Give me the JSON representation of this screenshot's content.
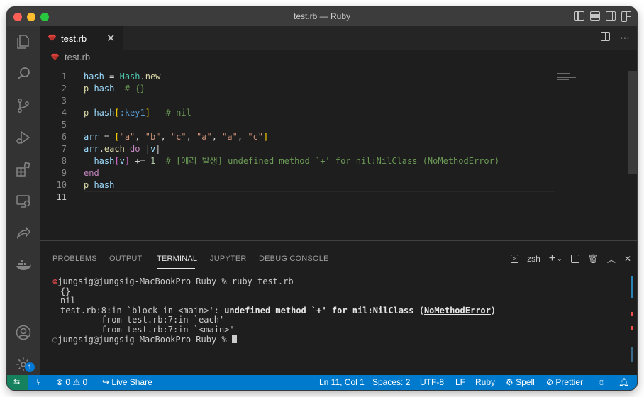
{
  "window": {
    "title": "test.rb — Ruby"
  },
  "tabs": [
    {
      "label": "test.rb",
      "close": "✕"
    }
  ],
  "breadcrumb": {
    "file": "test.rb"
  },
  "editor": {
    "line_numbers": [
      "1",
      "2",
      "3",
      "4",
      "5",
      "6",
      "7",
      "8",
      "9",
      "10",
      "11"
    ],
    "lines": [
      [
        {
          "t": "hash",
          "c": "k-var"
        },
        {
          "t": " = ",
          "c": "k-op"
        },
        {
          "t": "Hash",
          "c": "k-cls"
        },
        {
          "t": ".",
          "c": "k-op"
        },
        {
          "t": "new",
          "c": "k-fn"
        }
      ],
      [
        {
          "t": "p ",
          "c": "k-fn"
        },
        {
          "t": "hash",
          "c": "k-var"
        },
        {
          "t": "  # {}",
          "c": "k-com"
        }
      ],
      [],
      [
        {
          "t": "p ",
          "c": "k-fn"
        },
        {
          "t": "hash",
          "c": "k-var"
        },
        {
          "t": "[",
          "c": "k-br"
        },
        {
          "t": ":key1",
          "c": "k-sym"
        },
        {
          "t": "]",
          "c": "k-br"
        },
        {
          "t": "   # nil",
          "c": "k-com"
        }
      ],
      [],
      [
        {
          "t": "arr",
          "c": "k-var"
        },
        {
          "t": " = ",
          "c": "k-op"
        },
        {
          "t": "[",
          "c": "k-br"
        },
        {
          "t": "\"a\"",
          "c": "k-str"
        },
        {
          "t": ", ",
          "c": "k-op"
        },
        {
          "t": "\"b\"",
          "c": "k-str"
        },
        {
          "t": ", ",
          "c": "k-op"
        },
        {
          "t": "\"c\"",
          "c": "k-str"
        },
        {
          "t": ", ",
          "c": "k-op"
        },
        {
          "t": "\"a\"",
          "c": "k-str"
        },
        {
          "t": ", ",
          "c": "k-op"
        },
        {
          "t": "\"a\"",
          "c": "k-str"
        },
        {
          "t": ", ",
          "c": "k-op"
        },
        {
          "t": "\"c\"",
          "c": "k-str"
        },
        {
          "t": "]",
          "c": "k-br"
        }
      ],
      [
        {
          "t": "arr",
          "c": "k-var"
        },
        {
          "t": ".",
          "c": "k-op"
        },
        {
          "t": "each",
          "c": "k-fn"
        },
        {
          "t": " do ",
          "c": "k-kw"
        },
        {
          "t": "|",
          "c": "k-op"
        },
        {
          "t": "v",
          "c": "k-var"
        },
        {
          "t": "|",
          "c": "k-op"
        }
      ],
      [
        {
          "t": "  ",
          "c": "k-op"
        },
        {
          "t": "hash",
          "c": "k-var"
        },
        {
          "t": "[",
          "c": "k-br2"
        },
        {
          "t": "v",
          "c": "k-var"
        },
        {
          "t": "]",
          "c": "k-br2"
        },
        {
          "t": " += ",
          "c": "k-op"
        },
        {
          "t": "1",
          "c": "k-num"
        },
        {
          "t": "  # [에러 발생] undefined method `+' for nil:NilClass (NoMethodError)",
          "c": "k-com"
        }
      ],
      [
        {
          "t": "end",
          "c": "k-kw"
        }
      ],
      [
        {
          "t": "p ",
          "c": "k-fn"
        },
        {
          "t": "hash",
          "c": "k-var"
        }
      ],
      []
    ]
  },
  "panel": {
    "tabs": [
      "PROBLEMS",
      "OUTPUT",
      "TERMINAL",
      "JUPYTER",
      "DEBUG CONSOLE"
    ],
    "active_tab": "TERMINAL",
    "shell": "zsh",
    "terminal": {
      "prompt1": "jungsig@jungsig-MacBookPro Ruby % ruby test.rb",
      "out1": "{}",
      "out2": "nil",
      "err_prefix": "test.rb:8:in `block in <main>': ",
      "err_msg": "undefined method `+' for nil:NilClass (",
      "err_cls": "NoMethodError",
      "err_close": ")",
      "trace1": "        from test.rb:7:in `each'",
      "trace2": "        from test.rb:7:in `<main>'",
      "prompt2": "jungsig@jungsig-MacBookPro Ruby % "
    }
  },
  "status": {
    "errors": "0",
    "warnings": "0",
    "live_share": "Live Share",
    "position": "Ln 11, Col 1",
    "spaces": "Spaces: 2",
    "encoding": "UTF-8",
    "eol": "LF",
    "language": "Ruby",
    "spell": "Spell",
    "prettier": "Prettier"
  },
  "activity": {
    "badge": "1"
  },
  "colors": {
    "status_bar": "#007acc",
    "remote": "#16825d",
    "editor_bg": "#1e1e1e"
  }
}
